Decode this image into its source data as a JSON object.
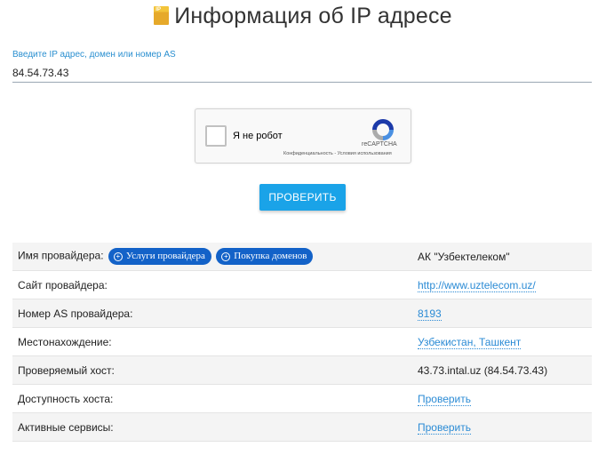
{
  "page": {
    "title": "Информация об IP адресе"
  },
  "search": {
    "label": "Введите IP адрес, домен или номер AS",
    "value": "84.54.73.43"
  },
  "captcha": {
    "checkbox_label": "Я не робот",
    "brand": "reCAPTCHA",
    "terms": "Конфиденциальность - Условия использования"
  },
  "check_button": {
    "label": "ПРОВЕРИТЬ"
  },
  "provider_buttons": {
    "services": "Услуги провайдера",
    "domains": "Покупка доменов"
  },
  "rows": [
    {
      "label": "Имя провайдера:",
      "value": "АК \"Узбектелеком\""
    },
    {
      "label": "Сайт провайдера:",
      "value": "http://www.uztelecom.uz/"
    },
    {
      "label": "Номер AS провайдера:",
      "value": "8193"
    },
    {
      "label": "Местонахождение:",
      "value": "Узбекистан, Ташкент"
    },
    {
      "label": "Проверяемый хост:",
      "value": "43.73.intal.uz (84.54.73.43)"
    },
    {
      "label": "Доступность хоста:",
      "value": "Проверить"
    },
    {
      "label": "Активные сервисы:",
      "value": "Проверить"
    }
  ],
  "colors": {
    "accent": "#1aa3e8",
    "pill": "#1362c8",
    "link": "#2b8bd5"
  }
}
